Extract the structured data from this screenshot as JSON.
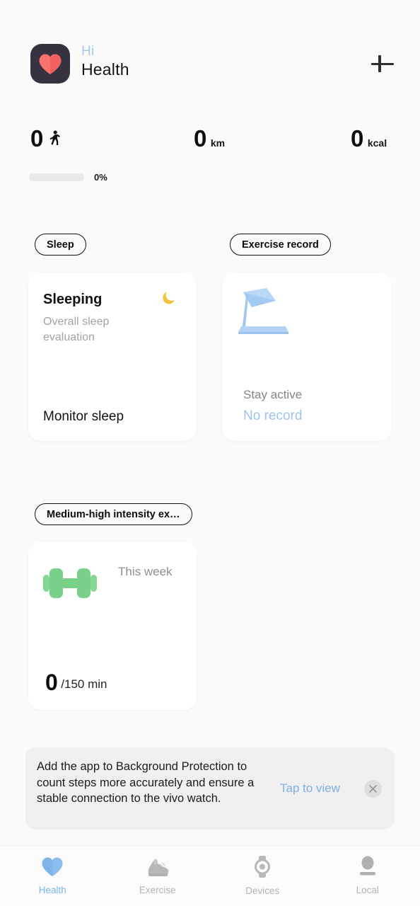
{
  "header": {
    "app_icon": "heart-app-icon",
    "greeting": "Hi",
    "title": "Health",
    "add_button": "plus-icon"
  },
  "stats": {
    "steps": {
      "value": "0",
      "icon": "walking-person-icon"
    },
    "distance": {
      "value": "0",
      "unit": "km"
    },
    "calories": {
      "value": "0",
      "unit": "kcal"
    },
    "progress": {
      "percent_label": "0%",
      "percent": 0
    }
  },
  "sections": {
    "sleep_chip": "Sleep",
    "exercise_chip": "Exercise record",
    "intensity_chip": "Medium-high intensity ex…"
  },
  "sleep_card": {
    "title": "Sleeping",
    "subtitle": "Overall sleep evaluation",
    "icon": "crescent-moon-icon",
    "action": "Monitor sleep"
  },
  "exercise_card": {
    "icon": "treadmill-icon",
    "subtitle": "Stay active",
    "status": "No record"
  },
  "intensity_card": {
    "icon": "dumbbell-icon",
    "period": "This week",
    "value": "0",
    "goal": "/150 min"
  },
  "banner": {
    "text": "Add the app to Background Protection to count steps more accurately and ensure a stable connection to the vivo watch.",
    "action": "Tap to view",
    "close": "close-icon"
  },
  "nav": {
    "items": [
      {
        "label": "Health",
        "icon": "heart-icon"
      },
      {
        "label": "Exercise",
        "icon": "running-shoe-icon"
      },
      {
        "label": "Devices",
        "icon": "smartwatch-icon"
      },
      {
        "label": "Local",
        "icon": "person-icon"
      }
    ]
  },
  "colors": {
    "accent_blue": "#7fb4ea",
    "heart_red": "#f96b6b",
    "icon_dark": "#363240",
    "dumbbell_green": "#79d189",
    "treadmill_blue": "#a8cbf0",
    "moon_yellow": "#f5c63c",
    "background": "#fafafa",
    "card": "#ffffff",
    "banner": "#f0f0f0"
  }
}
